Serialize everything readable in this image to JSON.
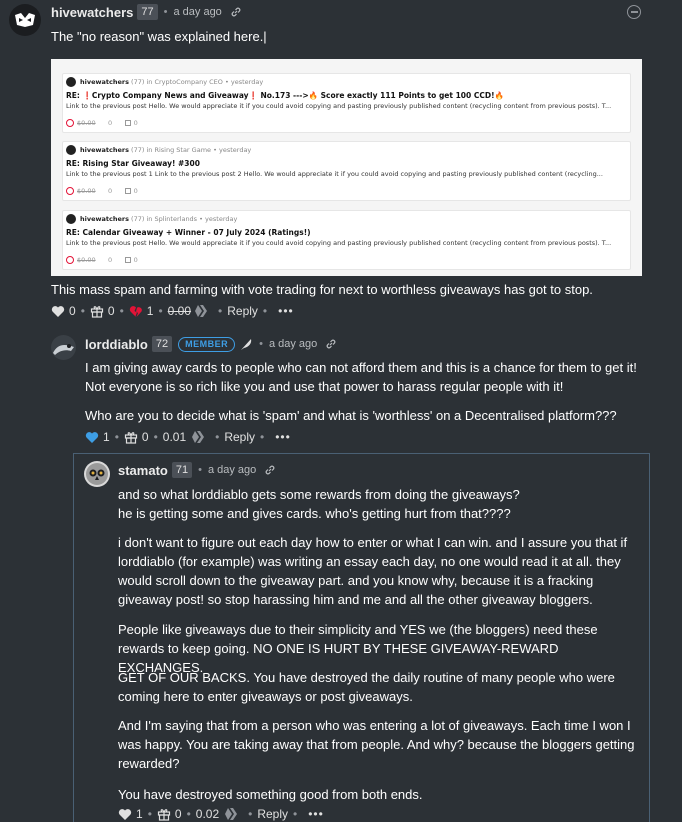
{
  "comment1": {
    "author": "hivewatchers",
    "reputation": "77",
    "time": "a day ago",
    "text1": "The \"no reason\" was explained here.|",
    "text2": "This mass spam and farming with vote trading for next to worthless giveaways has got to stop.",
    "upvotes": "0",
    "gifts": "0",
    "downvotes": "1",
    "payout": "0.00",
    "reply_label": "Reply",
    "more_label": "•••"
  },
  "screenshot": {
    "cards": [
      {
        "author": "hivewatchers",
        "context": "(77) in CryptoCompany CEO • yesterday",
        "title": "RE: ❗Crypto Company News and Giveaway❗ No.173 --->🔥 Score exactly 111 Points to get 100 CCD!🔥",
        "body": "Link to the previous post Hello. We would appreciate it if you could avoid copying and pasting previously published content (recycling content from previous posts). T...",
        "payout": "$0.00",
        "votes": "0",
        "comments": "0"
      },
      {
        "author": "hivewatchers",
        "context": "(77) in Rising Star Game • yesterday",
        "title": "RE: Rising Star Giveaway! #300",
        "body": "Link to the previous post 1 Link to the previous post 2 Hello. We would appreciate it if you could avoid copying and pasting previously published content (recycling...",
        "payout": "$0.00",
        "votes": "0",
        "comments": "0"
      },
      {
        "author": "hivewatchers",
        "context": "(77) in Splinterlands • yesterday",
        "title": "RE: Calendar Giveaway + Winner - 07 July 2024 (Ratings!)",
        "body": "Link to the previous post Hello. We would appreciate it if you could avoid copying and pasting previously published content (recycling content from previous posts). T...",
        "payout": "$0.00",
        "votes": "0",
        "comments": "0"
      }
    ]
  },
  "comment2": {
    "author": "lorddiablo",
    "reputation": "72",
    "badge": "MEMBER",
    "time": "a day ago",
    "text1": "I am giving away cards to people who can not afford them and this is a chance for them to get it! Not everyone is so rich like you and use that power to harass regular people with it!",
    "text2": "Who are you to decide what is 'spam' and what is 'worthless' on a Decentralised platform???",
    "upvotes": "1",
    "gifts": "0",
    "payout": "0.01",
    "reply_label": "Reply",
    "more_label": "•••"
  },
  "comment3": {
    "author": "stamato",
    "reputation": "71",
    "time": "a day ago",
    "p1a": "and so what lorddiablo gets some rewards from doing the giveaways?",
    "p1b": "he is getting some and gives cards. who's getting hurt from that????",
    "p2": "i don't want to figure out each day how to enter or what I can win. and I assure you that if lorddiablo (for example) was writing an essay each day, no one would read it at all. they would scroll down to the giveaway part. and you know why, because it is a fracking giveaway post! so stop harassing him and me and all the other giveaway bloggers.",
    "p3": "People like giveaways due to their simplicity and YES we (the bloggers) need these rewards to keep going. NO ONE IS HURT BY THESE GIVEAWAY-REWARD EXCHANGES.",
    "p4": "GET OF OUR BACKS. You have destroyed the daily routine of many people who were coming here to enter giveaways or post giveaways.",
    "p5": "And I'm saying that from a person who was entering a lot of giveaways. Each time I won I was happy. You are taking away that from people. And why? because the bloggers getting rewarded?",
    "p6": "You have destroyed something good from both ends.",
    "upvotes": "1",
    "gifts": "0",
    "payout": "0.02",
    "reply_label": "Reply",
    "more_label": "•••"
  },
  "colors": {
    "background": "#2c3136",
    "accent_blue": "#3e9ee5",
    "downvote_red": "#e31337"
  }
}
